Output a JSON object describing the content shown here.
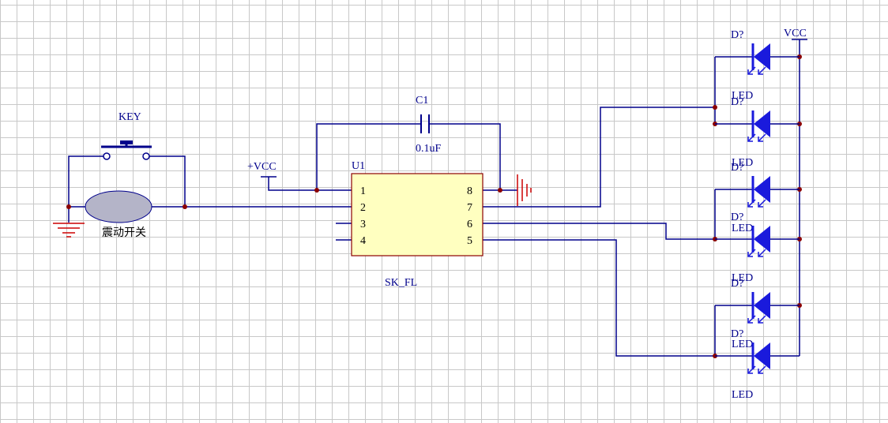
{
  "colors": {
    "grid": "#c8c8c8",
    "wire": "#00008b",
    "junction": "#8b0000",
    "power": "#cc0000",
    "led": "#1a1adc",
    "ic_fill": "#ffffc0",
    "ic_border": "#8b0000",
    "label": "#00008b"
  },
  "key": {
    "ref": "KEY"
  },
  "vibration_switch": {
    "label": "震动开关"
  },
  "capacitor": {
    "ref": "C1",
    "value": "0.1uF"
  },
  "power_left": {
    "label": "+VCC"
  },
  "ic": {
    "ref": "U1",
    "part": "SK_FL",
    "pins_left": [
      "1",
      "2",
      "3",
      "4"
    ],
    "pins_right": [
      "8",
      "7",
      "6",
      "5"
    ]
  },
  "led_column": {
    "vcc_label": "VCC",
    "leds": [
      {
        "ref": "D?",
        "value": "LED"
      },
      {
        "ref": "D?",
        "value": "LED"
      },
      {
        "ref": "D?",
        "value": "LED"
      },
      {
        "ref": "D?",
        "value": "LED"
      },
      {
        "ref": "D?",
        "value": "LED"
      },
      {
        "ref": "D?",
        "value": "LED"
      }
    ]
  }
}
